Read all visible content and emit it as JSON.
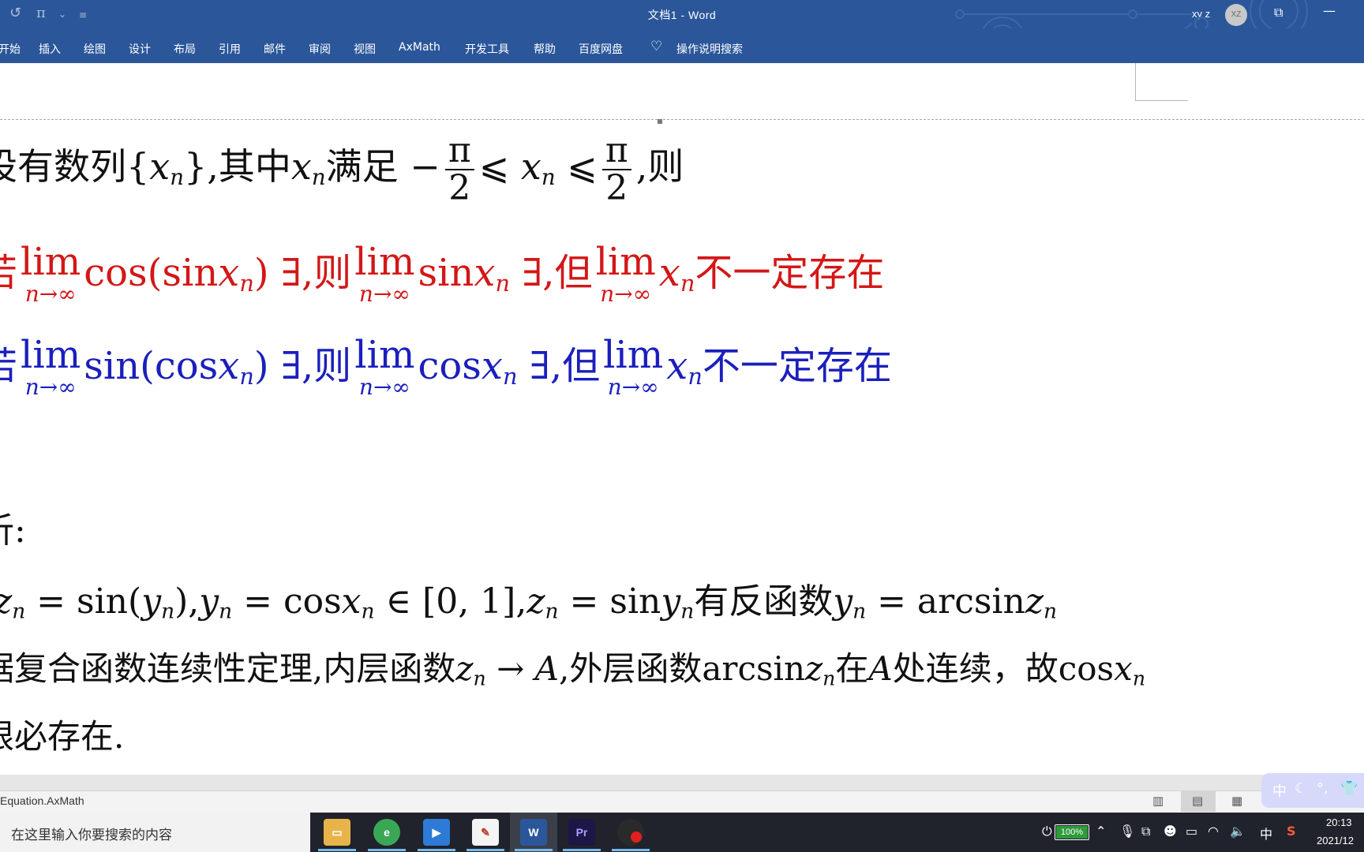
{
  "titlebar": {
    "document_title": "文档1  -  Word",
    "user_name": "xy z",
    "avatar_initials": "XZ",
    "qa_pi": "π",
    "qa_chevron": "⌄"
  },
  "ribbon": {
    "tabs": [
      "开始",
      "插入",
      "绘图",
      "设计",
      "布局",
      "引用",
      "邮件",
      "审阅",
      "视图",
      "AxMath",
      "开发工具",
      "帮助",
      "百度网盘"
    ],
    "tell_me": "操作说明搜索"
  },
  "doc": {
    "line1": {
      "a": "设有数列{",
      "x": "x",
      "n": "n",
      "b": "},其中",
      "c": "满足 −",
      "pi": "π",
      "two": "2",
      "le": "⩽",
      "d": ",则"
    },
    "line2": {
      "ruo": "若",
      "lim": "lim",
      "limsub": "n→∞",
      "cos": "cos",
      "lp": "(",
      "sin": "sin",
      "rp": ")",
      "exists": "∃",
      "ze": ",则",
      "dan": ",但",
      "tail": "不一定存在"
    },
    "line3": {
      "ruo": "若",
      "lim": "lim",
      "limsub": "n→∞",
      "sin": "sin",
      "lp": "(",
      "cos": "cos",
      "rp": ")",
      "exists": "∃",
      "ze": ",则",
      "dan": ",但",
      "tail": "不一定存在"
    },
    "line4": {
      "text": "析:"
    },
    "line5": {
      "z": "z",
      "y": "y",
      "x": "x",
      "n": "n",
      "eq": " = ",
      "sin": "sin",
      "cos": "cos",
      "arcsin": "arcsin",
      "lp": "(",
      "rp": ")",
      "comma": ",",
      "in": " ∈ ",
      "interval": "[0, 1]",
      "has_inverse": "有反函数"
    },
    "line6": {
      "lead": "据复合函数连续性定理,内层函数",
      "z": "z",
      "n": "n",
      "x": "x",
      "arrow": " → ",
      "A": "A",
      "outer": ",外层函数arcsin",
      "at": "在",
      "cont": "处连续，故cos"
    },
    "line7": {
      "text": "限必存在."
    }
  },
  "status": {
    "left_text": "Equation.AxMath"
  },
  "ime": {
    "label": "中"
  },
  "taskbar": {
    "search_placeholder": "在这里输入你要搜索的内容",
    "word_label": "W",
    "pr_label": "Pr",
    "battery": "100%",
    "ime_label": "中",
    "sogou_label": "S",
    "time": "20:13",
    "date": "2021/12"
  },
  "colors": {
    "ribbon": "#2b579a",
    "red_text": "#d31717",
    "blue_text": "#1b1fbc",
    "taskbar": "#20232b"
  },
  "icons": [
    "undo-icon",
    "lightbulb-icon",
    "restore-window-icon",
    "minimize-icon",
    "read-mode-icon",
    "print-layout-icon",
    "web-layout-icon",
    "file-explorer-icon",
    "browser-icon",
    "media-icon",
    "paint-icon",
    "word-icon",
    "premiere-icon",
    "recorder-icon"
  ]
}
